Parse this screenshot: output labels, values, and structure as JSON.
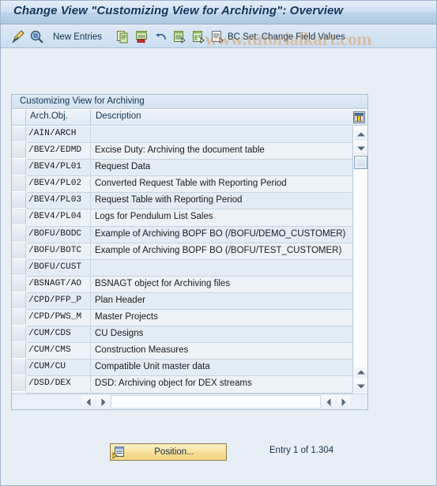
{
  "window": {
    "title": "Change View \"Customizing View for Archiving\": Overview"
  },
  "watermark": {
    "text": "www.tutorialkart.com"
  },
  "toolbar": {
    "items": [
      {
        "id": "display-change-icon",
        "icon": "pencil-display-change-icon",
        "label": ""
      },
      {
        "id": "check-icon",
        "icon": "magnifier-check-icon",
        "label": ""
      },
      {
        "id": "new-entries",
        "icon": "",
        "label": "New Entries"
      },
      {
        "id": "copy-as-icon",
        "icon": "copy-icon",
        "label": ""
      },
      {
        "id": "delete-icon",
        "icon": "delete-row-icon",
        "label": ""
      },
      {
        "id": "undo-icon",
        "icon": "undo-icon",
        "label": ""
      },
      {
        "id": "select-all-icon",
        "icon": "select-all-icon",
        "label": ""
      },
      {
        "id": "deselect-all-icon",
        "icon": "deselect-all-icon",
        "label": ""
      },
      {
        "id": "bc-set-change-field-values",
        "icon": "variant-icon",
        "label": "BC Set: Change Field Values"
      }
    ],
    "new_entries_label": "New Entries",
    "bc_set_label": "BC Set: Change Field Values"
  },
  "table": {
    "caption": "Customizing View for Archiving",
    "columns": [
      {
        "key": "arch_obj",
        "label": "Arch.Obj."
      },
      {
        "key": "description",
        "label": "Description"
      }
    ],
    "config_icon": "table-settings-icon",
    "rows": [
      {
        "arch_obj": "/AIN/ARCH",
        "description": ""
      },
      {
        "arch_obj": "/BEV2/EDMD",
        "description": "Excise Duty: Archiving the document table"
      },
      {
        "arch_obj": "/BEV4/PL01",
        "description": "Request Data"
      },
      {
        "arch_obj": "/BEV4/PL02",
        "description": "Converted Request Table with Reporting Period"
      },
      {
        "arch_obj": "/BEV4/PL03",
        "description": "Request Table with Reporting Period"
      },
      {
        "arch_obj": "/BEV4/PL04",
        "description": "Logs for Pendulum List Sales"
      },
      {
        "arch_obj": "/BOFU/BODC",
        "description": "Example of Archiving BOPF BO (/BOFU/DEMO_CUSTOMER)"
      },
      {
        "arch_obj": "/BOFU/BOTC",
        "description": "Example of Archiving BOPF BO (/BOFU/TEST_CUSTOMER)"
      },
      {
        "arch_obj": "/BOFU/CUST",
        "description": ""
      },
      {
        "arch_obj": "/BSNAGT/AO",
        "description": "BSNAGT object for Archiving files"
      },
      {
        "arch_obj": "/CPD/PFP_P",
        "description": "Plan Header"
      },
      {
        "arch_obj": "/CPD/PWS_M",
        "description": "Master Projects"
      },
      {
        "arch_obj": "/CUM/CDS",
        "description": "CU Designs"
      },
      {
        "arch_obj": "/CUM/CMS",
        "description": "Construction Measures"
      },
      {
        "arch_obj": "/CUM/CU",
        "description": "Compatible Unit master data"
      },
      {
        "arch_obj": "/DSD/DEX",
        "description": "DSD: Archiving object for DEX streams"
      }
    ]
  },
  "footer": {
    "position_label": "Position...",
    "position_icon": "position-icon",
    "entry_status": "Entry 1 of 1.304"
  },
  "colors": {
    "title_text": "#15355c",
    "accent_button": "#f3d685",
    "watermark": "#dd8c3c",
    "row_odd": "#e3ecf5",
    "row_even": "#edf2f8"
  }
}
